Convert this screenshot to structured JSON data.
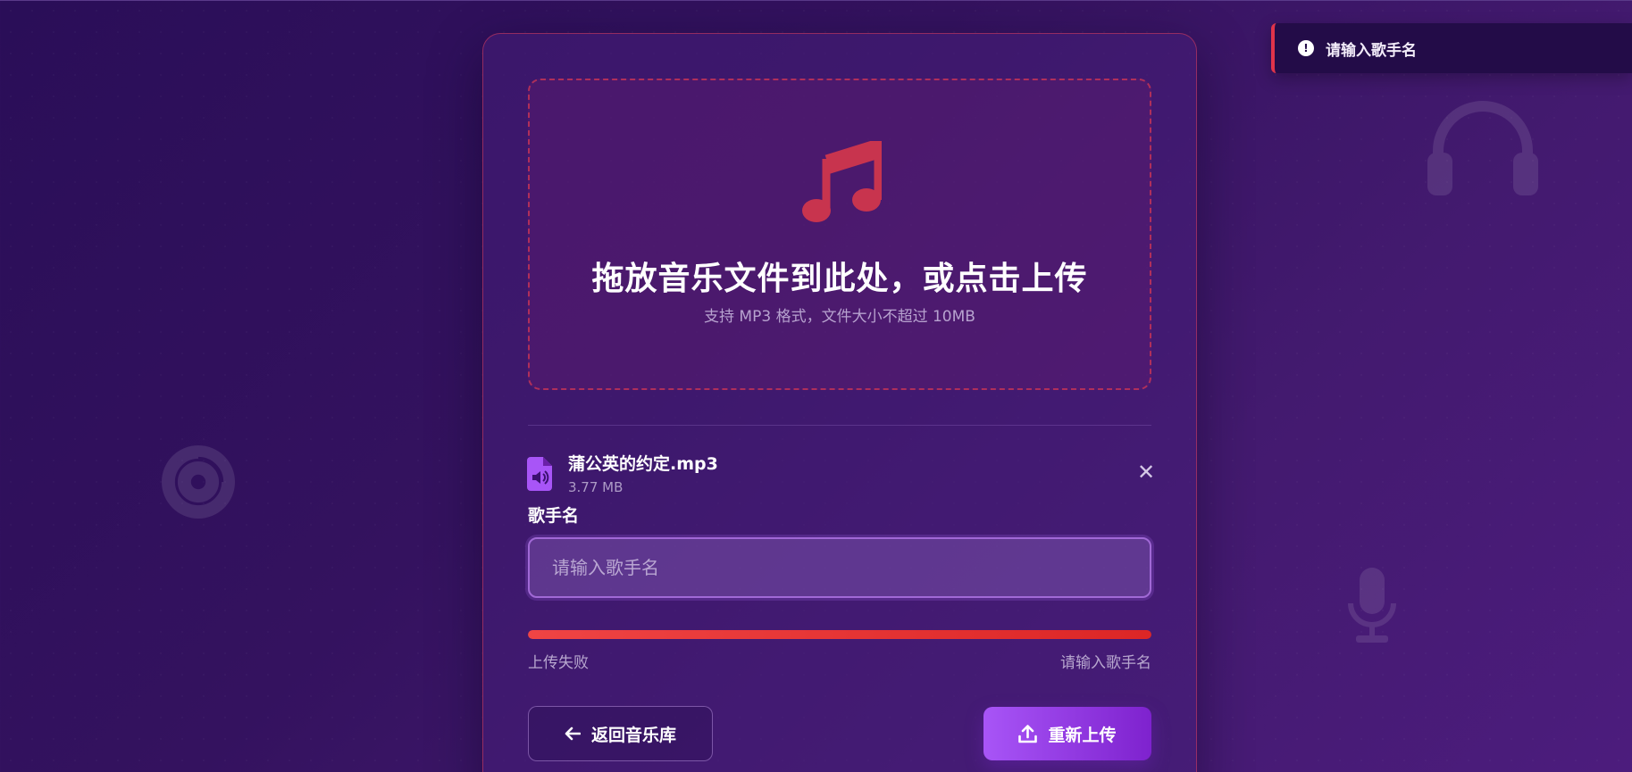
{
  "toast": {
    "icon": "exclamation-circle-icon",
    "message": "请输入歌手名"
  },
  "upload": {
    "icon": "music-note-icon",
    "title": "拖放音乐文件到此处，或点击上传",
    "subtitle": "支持 MP3 格式，文件大小不超过 10MB"
  },
  "file": {
    "icon": "audio-file-icon",
    "name": "蒲公英的约定.mp3",
    "size": "3.77 MB",
    "remove_icon": "close-icon"
  },
  "artist": {
    "label": "歌手名",
    "placeholder": "请输入歌手名",
    "value": ""
  },
  "progress": {
    "value_percent": 100,
    "status_left": "上传失败",
    "status_right": "请输入歌手名",
    "color": "#ef4444"
  },
  "actions": {
    "back_label": "返回音乐库",
    "back_icon": "arrow-left-icon",
    "reupload_label": "重新上传",
    "reupload_icon": "upload-icon"
  },
  "decor_icons": [
    "disc-icon",
    "headphones-icon",
    "microphone-icon"
  ],
  "colors": {
    "accent_red": "#c8344e",
    "accent_purple": "#a855f7",
    "background": "#34125f"
  }
}
